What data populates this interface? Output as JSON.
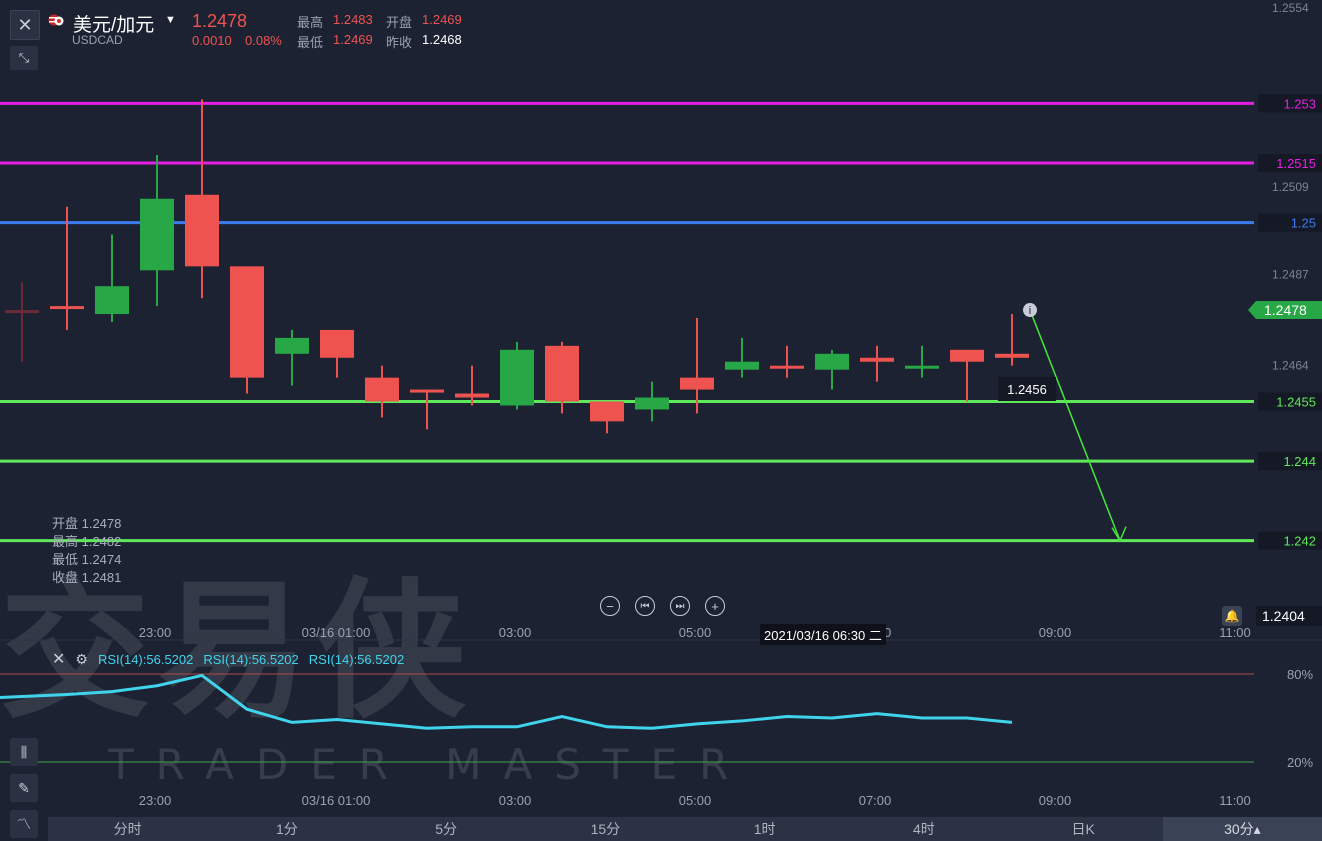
{
  "header": {
    "symbol_name": "美元/加元",
    "symbol_code": "USDCAD",
    "last_price": "1.2478",
    "change": "0.0010",
    "change_pct": "0.08%",
    "high_label": "最高",
    "high_value": "1.2483",
    "open_label": "开盘",
    "open_value": "1.2469",
    "low_label": "最低",
    "low_value": "1.2469",
    "prev_close_label": "昨收",
    "prev_close_value": "1.2468"
  },
  "ohlc_panel": {
    "open": "开盘 1.2478",
    "high": "最高 1.2482",
    "low": "最低 1.2474",
    "close": "收盘 1.2481"
  },
  "watermark": {
    "cn": "交易侠",
    "en": "TRADER MASTER"
  },
  "chart_data": {
    "type": "candlestick",
    "x_axis_labels": [
      "23:00",
      "03/16 01:00",
      "03:00",
      "05:00",
      "07:00",
      "09:00",
      "11:00"
    ],
    "y_axis_ticks": [
      "1.2554",
      "1.2509",
      "1.2487",
      "1.2464"
    ],
    "ylim": [
      1.2395,
      1.2556
    ],
    "candles": [
      {
        "o": 1.2478,
        "h": 1.2485,
        "l": 1.2465,
        "c": 1.2478,
        "dir": "flat_dim"
      },
      {
        "o": 1.2479,
        "h": 1.2504,
        "l": 1.2473,
        "c": 1.2479,
        "dir": "down"
      },
      {
        "o": 1.2477,
        "h": 1.2497,
        "l": 1.2475,
        "c": 1.2484,
        "dir": "up"
      },
      {
        "o": 1.2506,
        "h": 1.2517,
        "l": 1.2479,
        "c": 1.2488,
        "dir": "up"
      },
      {
        "o": 1.2489,
        "h": 1.2531,
        "l": 1.2481,
        "c": 1.2507,
        "dir": "down"
      },
      {
        "o": 1.2489,
        "h": 1.2489,
        "l": 1.2457,
        "c": 1.2461,
        "dir": "down"
      },
      {
        "o": 1.2467,
        "h": 1.2473,
        "l": 1.2459,
        "c": 1.2471,
        "dir": "up"
      },
      {
        "o": 1.2466,
        "h": 1.2468,
        "l": 1.2461,
        "c": 1.2473,
        "dir": "down"
      },
      {
        "o": 1.2461,
        "h": 1.2464,
        "l": 1.2451,
        "c": 1.2455,
        "dir": "down"
      },
      {
        "o": 1.2458,
        "h": 1.2458,
        "l": 1.2448,
        "c": 1.2458,
        "dir": "down"
      },
      {
        "o": 1.2456,
        "h": 1.2464,
        "l": 1.2454,
        "c": 1.2457,
        "dir": "down"
      },
      {
        "o": 1.2454,
        "h": 1.247,
        "l": 1.2453,
        "c": 1.2468,
        "dir": "up"
      },
      {
        "o": 1.2469,
        "h": 1.247,
        "l": 1.2452,
        "c": 1.2455,
        "dir": "down"
      },
      {
        "o": 1.245,
        "h": 1.2455,
        "l": 1.2447,
        "c": 1.2455,
        "dir": "down"
      },
      {
        "o": 1.2453,
        "h": 1.246,
        "l": 1.245,
        "c": 1.2456,
        "dir": "up"
      },
      {
        "o": 1.2458,
        "h": 1.2476,
        "l": 1.2452,
        "c": 1.2461,
        "dir": "down"
      },
      {
        "o": 1.2463,
        "h": 1.2471,
        "l": 1.2461,
        "c": 1.2465,
        "dir": "up"
      },
      {
        "o": 1.2464,
        "h": 1.2469,
        "l": 1.2461,
        "c": 1.2464,
        "dir": "down"
      },
      {
        "o": 1.2463,
        "h": 1.2468,
        "l": 1.2458,
        "c": 1.2467,
        "dir": "up"
      },
      {
        "o": 1.2465,
        "h": 1.2469,
        "l": 1.246,
        "c": 1.2466,
        "dir": "down"
      },
      {
        "o": 1.2464,
        "h": 1.2469,
        "l": 1.2461,
        "c": 1.2464,
        "dir": "up"
      },
      {
        "o": 1.2465,
        "h": 1.2467,
        "l": 1.2455,
        "c": 1.2468,
        "dir": "down"
      },
      {
        "o": 1.2467,
        "h": 1.2477,
        "l": 1.2464,
        "c": 1.2466,
        "dir": "down"
      }
    ],
    "horizontal_lines": [
      {
        "value": 1.253,
        "label": "1.253",
        "color": "#e91ee6"
      },
      {
        "value": 1.2515,
        "label": "1.2515",
        "color": "#e91ee6"
      },
      {
        "value": 1.25,
        "label": "1.25",
        "color": "#3b7cf0"
      },
      {
        "value": 1.2455,
        "label": "1.2455",
        "color": "#5fe85a"
      },
      {
        "value": 1.244,
        "label": "1.244",
        "color": "#5fe85a"
      },
      {
        "value": 1.242,
        "label": "1.242",
        "color": "#5fe85a"
      }
    ],
    "current_price": {
      "value": 1.2478,
      "label": "1.2478"
    },
    "crosshair_price": "1.2404",
    "projection_label": "1.2456",
    "projection_from": {
      "candle_index": 22.4,
      "value": 1.2478
    },
    "projection_to": {
      "candle_index": 24.4,
      "value": 1.242
    },
    "time_tooltip": "2021/03/16 06:30 二",
    "rsi": {
      "labels": [
        "RSI(14):56.5202",
        "RSI(14):56.5202",
        "RSI(14):56.5202"
      ],
      "levels": [
        "80%",
        "20%"
      ],
      "values": [
        64,
        66,
        68,
        72,
        79,
        56,
        47,
        49,
        46,
        43,
        44,
        44,
        51,
        44,
        43,
        46,
        48,
        51,
        50,
        53,
        50,
        50,
        47
      ]
    },
    "colors": {
      "up": "#27a745",
      "down": "#ef5350",
      "bg": "#1c2232",
      "rsi": "#3fd4ec"
    }
  },
  "controls": {
    "zoom_out": "−",
    "go_start": "⏮",
    "go_end": "⏭",
    "zoom_in": "+"
  },
  "timeframes": [
    "分时",
    "1分",
    "5分",
    "15分",
    "1时",
    "4时",
    "日K",
    "30分▴"
  ]
}
